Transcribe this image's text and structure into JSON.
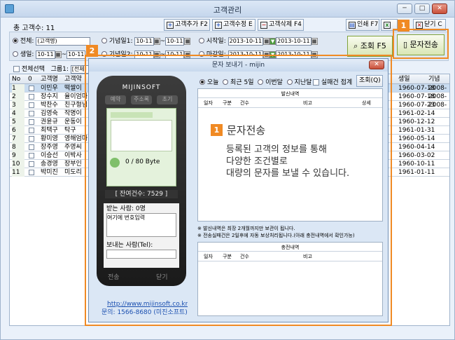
{
  "window": {
    "title": "고객관리",
    "min": "─",
    "max": "□",
    "close": "✕"
  },
  "customer_count": "총 고객수: 11",
  "toolbar": [
    {
      "icon": "+",
      "label": "고객추가 F2",
      "color": "#2a58c4"
    },
    {
      "icon": "+",
      "label": "고객수정 E",
      "color": "#2a58c4"
    },
    {
      "icon": "−",
      "label": "고객삭제 F4",
      "color": "#c62f2f"
    },
    {
      "icon": "▤",
      "label": "인쇄 F7",
      "color": "#2a58c4"
    },
    {
      "icon": "x",
      "label": "엑셀",
      "color": "#2a8a2a"
    },
    {
      "icon": "×",
      "label": "닫기 C",
      "color": "#c62f2f"
    }
  ],
  "filters": {
    "all_label": "전체:",
    "all_placeholder": "(고객명)",
    "birth_label": "생일:",
    "birth_from": "10-11",
    "birth_to": "10-11",
    "anniv1_label": "기념일1:",
    "anniv1_from": "10-11",
    "anniv1_to": "10-11",
    "anniv2_label": "기념일2:",
    "anniv2_from": "10-11",
    "anniv2_to": "10-11",
    "start_label": "시작일:",
    "start_from": "2013-10-11",
    "start_to": "2013-10-11",
    "end_label": "마감일:",
    "end_from": "2013-10-11",
    "end_to": "2013-10-11",
    "tilde": "~",
    "cal": "▦",
    "arrow": "▼"
  },
  "actions": {
    "search_label": "조회 F5",
    "sms_label": "문자전송"
  },
  "callouts": {
    "one": "1",
    "two": "2"
  },
  "select_bar": {
    "select_all": "전체선택",
    "group_label": "그룹1:",
    "group_value": "[전체]"
  },
  "grid": {
    "headers": {
      "no": "No",
      "chk": "0",
      "name": "고객명",
      "code": "고객약",
      "birth": "생일",
      "anniv": "기념"
    },
    "rows": [
      {
        "no": "1",
        "name": "이민우",
        "code": "떡쌀이",
        "birth": "1960-07-18",
        "anniv": "2008-"
      },
      {
        "no": "2",
        "name": "장수지",
        "code": "율이엄마",
        "birth": "1960-07-18",
        "anniv": "2008-"
      },
      {
        "no": "3",
        "name": "박찬수",
        "code": "친구형님",
        "birth": "1960-07-23",
        "anniv": "2008-"
      },
      {
        "no": "4",
        "name": "김영숙",
        "code": "작명이",
        "birth": "1961-02-14",
        "anniv": ""
      },
      {
        "no": "5",
        "name": "권윤규",
        "code": "운동이",
        "birth": "1960-12-12",
        "anniv": ""
      },
      {
        "no": "6",
        "name": "최택구",
        "code": "탁구",
        "birth": "1961-01-31",
        "anniv": ""
      },
      {
        "no": "7",
        "name": "황미영",
        "code": "영해엄마",
        "birth": "1960-05-14",
        "anniv": ""
      },
      {
        "no": "8",
        "name": "장주영",
        "code": "주영씨",
        "birth": "1960-04-14",
        "anniv": ""
      },
      {
        "no": "9",
        "name": "이승선",
        "code": "이박사",
        "birth": "1960-03-02",
        "anniv": ""
      },
      {
        "no": "10",
        "name": "송경영",
        "code": "장부인",
        "birth": "1960-10-11",
        "anniv": ""
      },
      {
        "no": "11",
        "name": "박미진",
        "code": "미도리",
        "birth": "1961-01-11",
        "anniv": ""
      }
    ]
  },
  "popup": {
    "title": "문자 보내기 - mijin",
    "close": "✕",
    "brand": "MIJINSOFT",
    "phone_buttons": [
      "예약",
      "주소록",
      "초기"
    ],
    "counter": "0 / 80 Byte",
    "remaining": "[ 잔여건수: 7529 ]",
    "to_label": "받는 사람: 0명",
    "to_placeholder": "여기에 번호입력",
    "from_label": "보내는 사람(Tel):",
    "bottom_buttons": [
      "전송",
      "닫기"
    ],
    "url": "http://www.mijinsoft.co.kr",
    "contact": "문의: 1566-8680 (미진소프트)",
    "periods": [
      "오늘",
      "최근 5일",
      "이번달",
      "지난달"
    ],
    "fail_check": "실패건 접계",
    "search_btn": "조회(Q)",
    "sent_title": "발신내역",
    "sent_cols": [
      "일자",
      "구분",
      "건수",
      "비고",
      "상세"
    ],
    "notes": [
      "※ 발신내역은 최장 2개월까지만 보관이 됩니다.",
      "※ 전송실패건은 2일후에 자동 보상처리됩니다.(아래 충전내역에서 확인가능)"
    ],
    "charge_title": "충전내역",
    "charge_cols": [
      "일자",
      "구분",
      "건수",
      "비고"
    ]
  },
  "overlay": {
    "badge": "1",
    "title": "문자전송",
    "lines": [
      "등록된 고객의 정보를 통해",
      "다양한 조건별로",
      "대량의 문자를 보낼 수 있습니다."
    ]
  },
  "colors": {
    "accent": "#f08a24",
    "titlebar": "#c5d6ec",
    "selection": "#c9dcf0"
  }
}
